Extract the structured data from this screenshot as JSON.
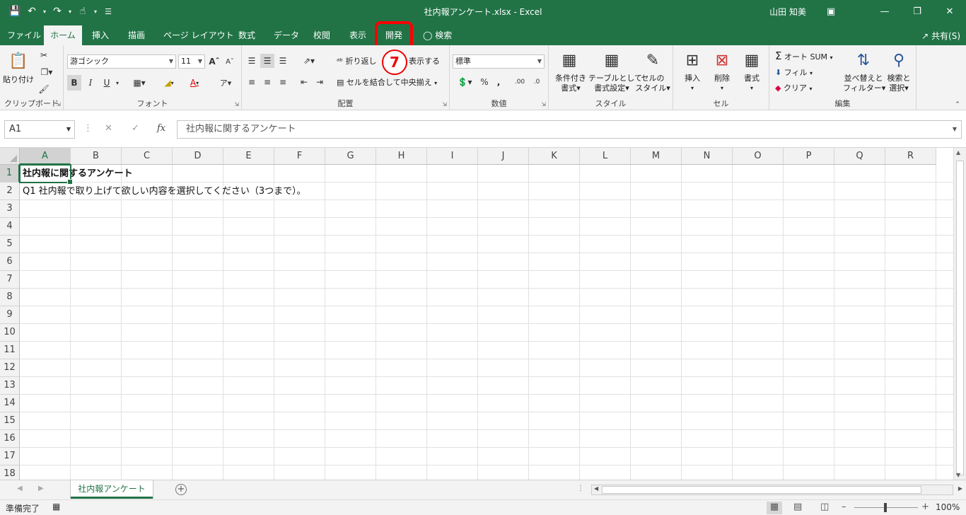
{
  "window": {
    "title": "社内報アンケート.xlsx  -  Excel",
    "user": "山田 知美"
  },
  "tabs": [
    {
      "label": "ファイル"
    },
    {
      "label": "ホーム"
    },
    {
      "label": "挿入"
    },
    {
      "label": "描画"
    },
    {
      "label": "ページ レイアウト"
    },
    {
      "label": "数式"
    },
    {
      "label": "データ"
    },
    {
      "label": "校閲"
    },
    {
      "label": "表示"
    },
    {
      "label": "開発"
    },
    {
      "label": "検索"
    }
  ],
  "share_label": "共有(S)",
  "ribbon": {
    "clipboard": {
      "label": "クリップボード",
      "paste": "貼り付け"
    },
    "font": {
      "label": "フォント",
      "name": "游ゴシック",
      "size": "11",
      "bold": "B",
      "italic": "I",
      "underline": "U"
    },
    "alignment": {
      "label": "配置",
      "wrap": "折り返して全体を表示する",
      "wrap_visible_left": "折り返し",
      "wrap_visible_right": "表示する",
      "merge": "セルを結合して中央揃え"
    },
    "number": {
      "label": "数値",
      "format": "標準"
    },
    "styles": {
      "label": "スタイル",
      "cond_format_1": "条件付き",
      "cond_format_2": "書式",
      "table_1": "テーブルとして",
      "table_2": "書式設定",
      "cell_style_1": "セルの",
      "cell_style_2": "スタイル"
    },
    "cells": {
      "label": "セル",
      "insert": "挿入",
      "delete": "削除",
      "format": "書式"
    },
    "editing": {
      "label": "編集",
      "autosum": "オート SUM",
      "fill": "フィル",
      "clear": "クリア",
      "sort_1": "並べ替えと",
      "sort_2": "フィルター",
      "find_1": "検索と",
      "find_2": "選択"
    }
  },
  "annotation": {
    "step": "7"
  },
  "formula_bar": {
    "name_box": "A1",
    "content": "社内報に関するアンケート",
    "fx": "fx"
  },
  "columns": [
    "A",
    "B",
    "C",
    "D",
    "E",
    "F",
    "G",
    "H",
    "I",
    "J",
    "K",
    "L",
    "M",
    "N",
    "O",
    "P",
    "Q",
    "R"
  ],
  "rows": [
    "1",
    "2",
    "3",
    "4",
    "5",
    "6",
    "7",
    "8",
    "9",
    "10",
    "11",
    "12",
    "13",
    "14",
    "15",
    "16",
    "17",
    "18"
  ],
  "cells": {
    "a1": "社内報に関するアンケート",
    "a2": "Q1 社内報で取り上げて欲しい内容を選択してください（3つまで）。"
  },
  "sheet_tab": "社内報アンケート",
  "status": {
    "text": "準備完了",
    "zoom": "100%"
  }
}
